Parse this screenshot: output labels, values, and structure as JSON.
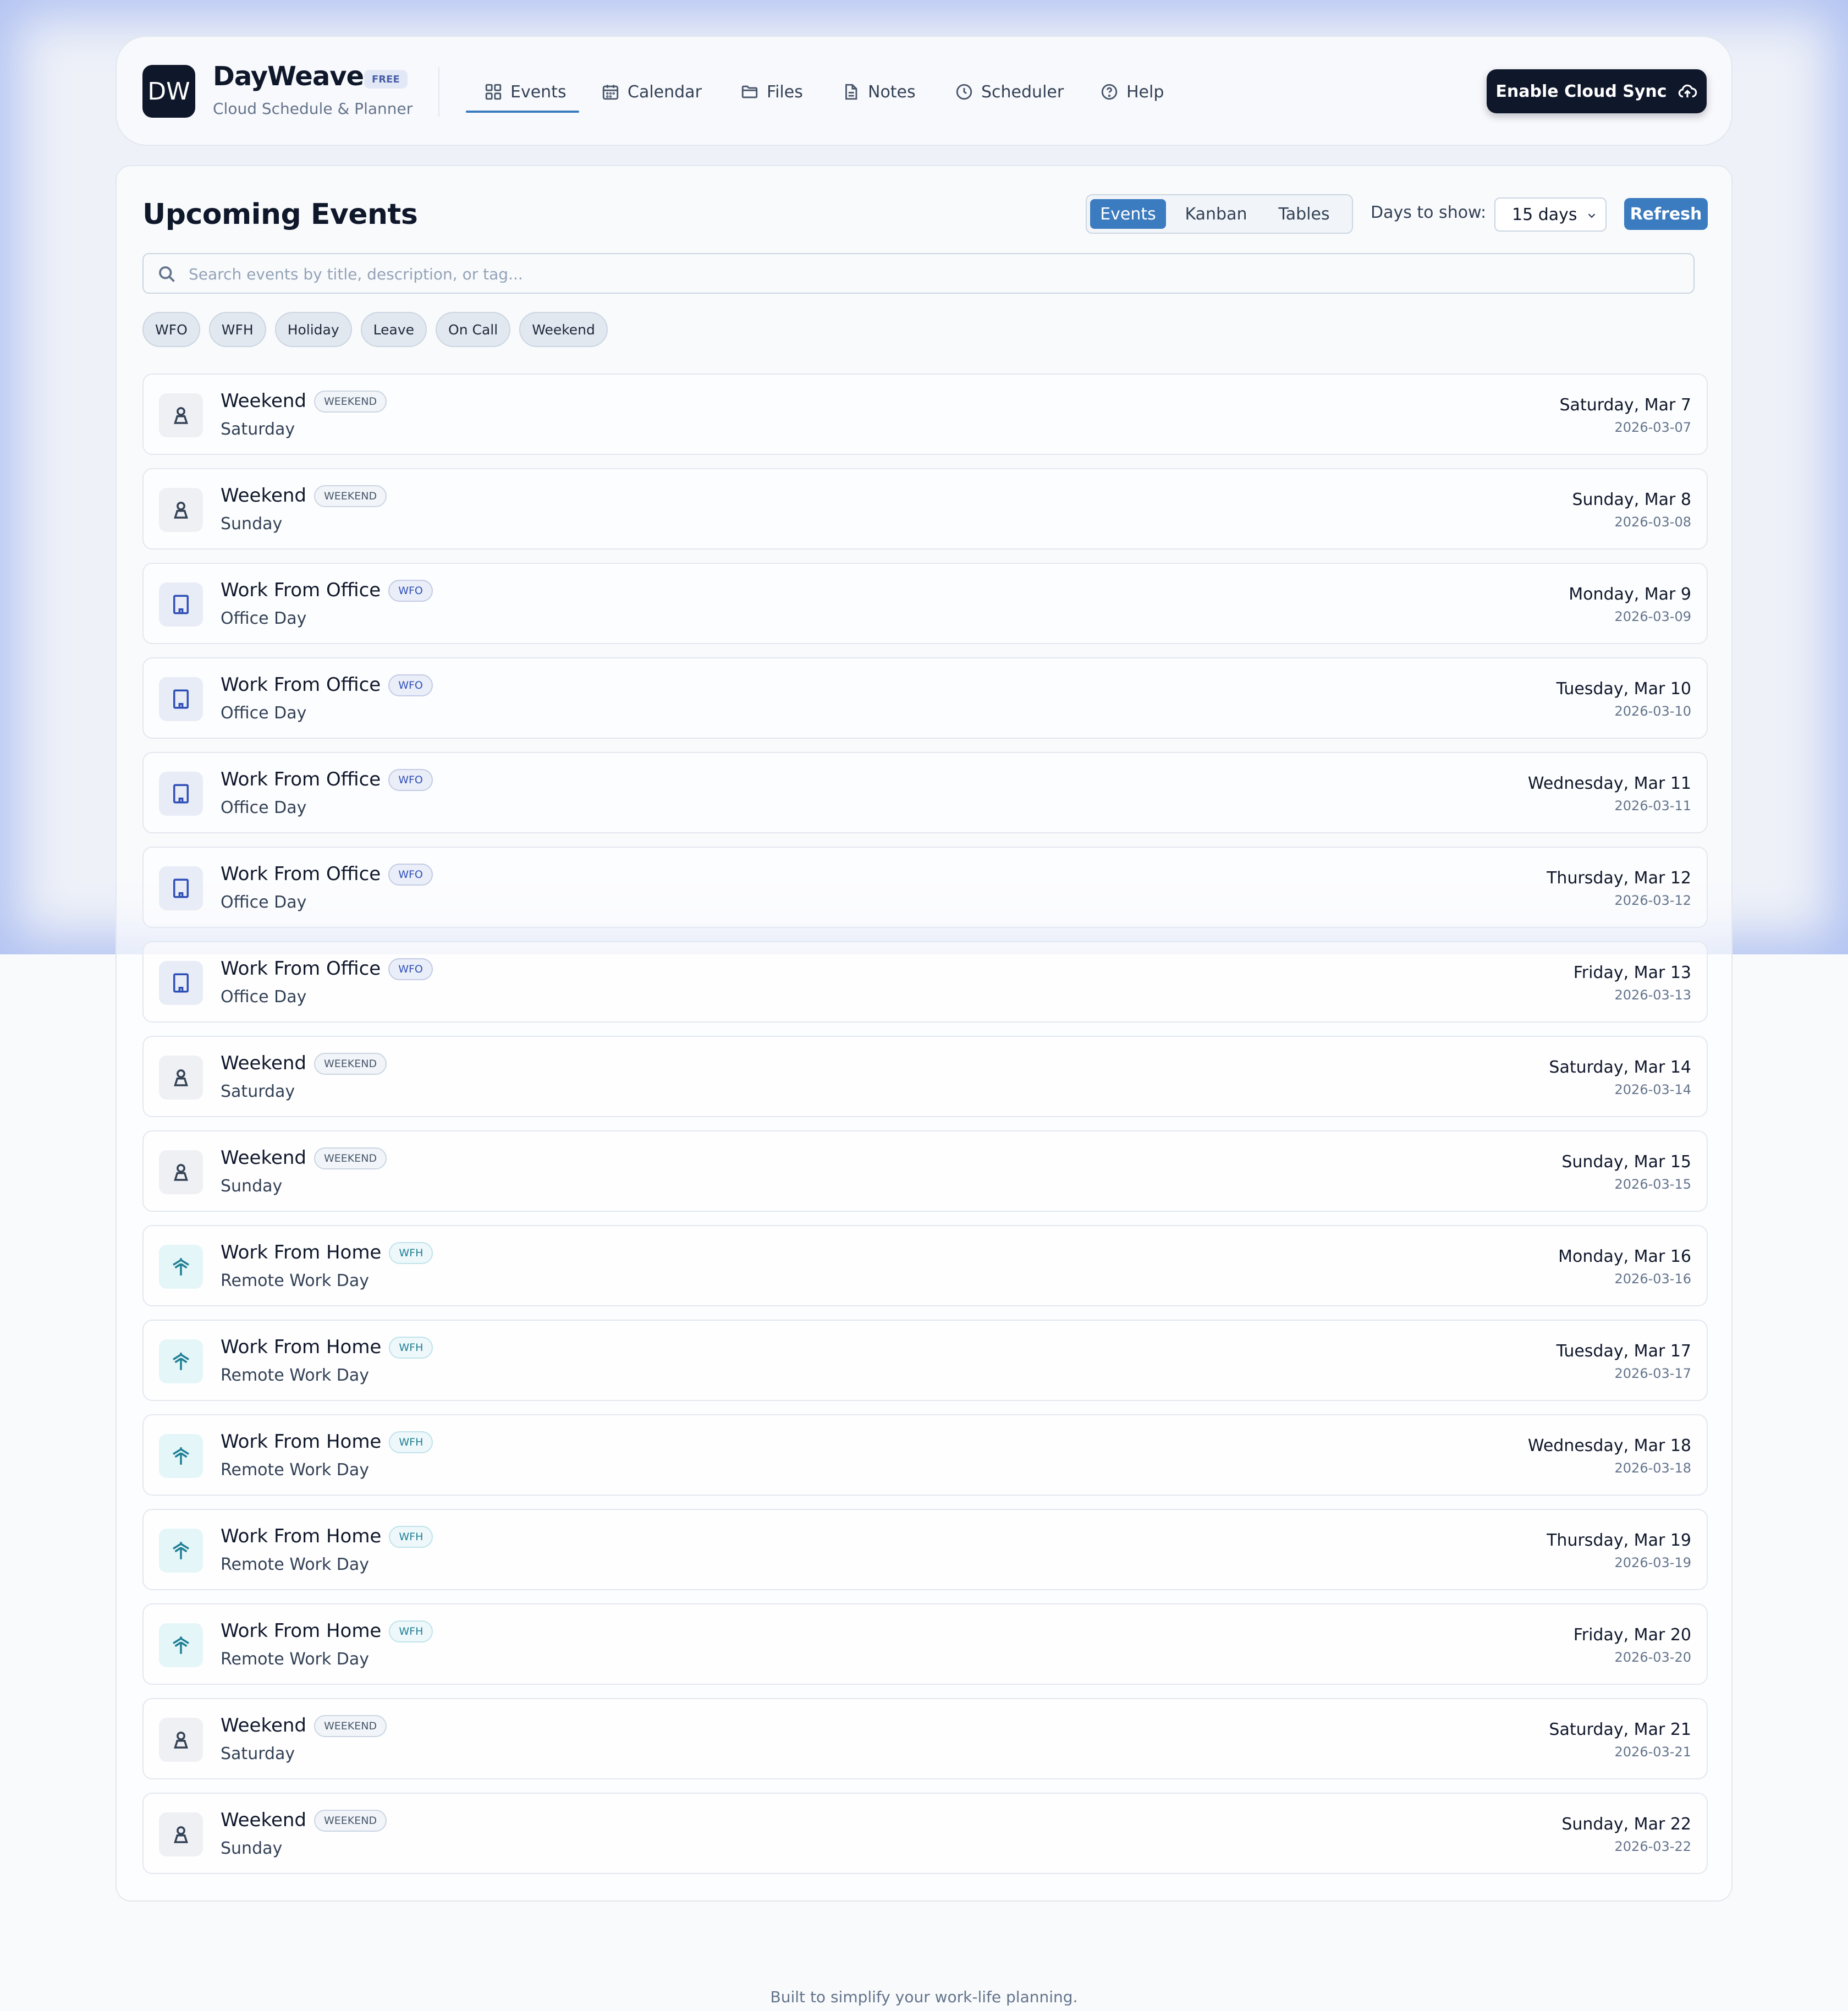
{
  "brand": {
    "logo": "DW",
    "name": "DayWeave",
    "badge": "FREE",
    "subtitle": "Cloud Schedule & Planner"
  },
  "nav": [
    {
      "label": "Events",
      "icon": "grid-icon",
      "active": true
    },
    {
      "label": "Calendar",
      "icon": "calendar-icon"
    },
    {
      "label": "Files",
      "icon": "folder-icon"
    },
    {
      "label": "Notes",
      "icon": "document-icon"
    },
    {
      "label": "Scheduler",
      "icon": "clock-icon"
    },
    {
      "label": "Help",
      "icon": "help-circle-icon"
    }
  ],
  "cloud_button": {
    "label": "Enable Cloud Sync",
    "icon": "cloud-upload-icon"
  },
  "main": {
    "title": "Upcoming Events",
    "views": [
      {
        "label": "Events",
        "active": true
      },
      {
        "label": "Kanban"
      },
      {
        "label": "Tables"
      }
    ],
    "days_label": "Days to show:",
    "days_value": "15 days",
    "refresh_label": "Refresh",
    "search_placeholder": "Search events by title, description, or tag...",
    "search_value": "",
    "tags": [
      "WFO",
      "WFH",
      "Holiday",
      "Leave",
      "On Call",
      "Weekend"
    ]
  },
  "events": [
    {
      "type": "weekend",
      "title": "Weekend",
      "badge": "WEEKEND",
      "subtitle": "Saturday",
      "date": "Saturday, Mar 7",
      "iso": "2026-03-07"
    },
    {
      "type": "weekend",
      "title": "Weekend",
      "badge": "WEEKEND",
      "subtitle": "Sunday",
      "date": "Sunday, Mar 8",
      "iso": "2026-03-08"
    },
    {
      "type": "wfo",
      "title": "Work From Office",
      "badge": "WFO",
      "subtitle": "Office Day",
      "date": "Monday, Mar 9",
      "iso": "2026-03-09"
    },
    {
      "type": "wfo",
      "title": "Work From Office",
      "badge": "WFO",
      "subtitle": "Office Day",
      "date": "Tuesday, Mar 10",
      "iso": "2026-03-10"
    },
    {
      "type": "wfo",
      "title": "Work From Office",
      "badge": "WFO",
      "subtitle": "Office Day",
      "date": "Wednesday, Mar 11",
      "iso": "2026-03-11"
    },
    {
      "type": "wfo",
      "title": "Work From Office",
      "badge": "WFO",
      "subtitle": "Office Day",
      "date": "Thursday, Mar 12",
      "iso": "2026-03-12"
    },
    {
      "type": "wfo",
      "title": "Work From Office",
      "badge": "WFO",
      "subtitle": "Office Day",
      "date": "Friday, Mar 13",
      "iso": "2026-03-13"
    },
    {
      "type": "weekend",
      "title": "Weekend",
      "badge": "WEEKEND",
      "subtitle": "Saturday",
      "date": "Saturday, Mar 14",
      "iso": "2026-03-14"
    },
    {
      "type": "weekend",
      "title": "Weekend",
      "badge": "WEEKEND",
      "subtitle": "Sunday",
      "date": "Sunday, Mar 15",
      "iso": "2026-03-15"
    },
    {
      "type": "wfh",
      "title": "Work From Home",
      "badge": "WFH",
      "subtitle": "Remote Work Day",
      "date": "Monday, Mar 16",
      "iso": "2026-03-16"
    },
    {
      "type": "wfh",
      "title": "Work From Home",
      "badge": "WFH",
      "subtitle": "Remote Work Day",
      "date": "Tuesday, Mar 17",
      "iso": "2026-03-17"
    },
    {
      "type": "wfh",
      "title": "Work From Home",
      "badge": "WFH",
      "subtitle": "Remote Work Day",
      "date": "Wednesday, Mar 18",
      "iso": "2026-03-18"
    },
    {
      "type": "wfh",
      "title": "Work From Home",
      "badge": "WFH",
      "subtitle": "Remote Work Day",
      "date": "Thursday, Mar 19",
      "iso": "2026-03-19"
    },
    {
      "type": "wfh",
      "title": "Work From Home",
      "badge": "WFH",
      "subtitle": "Remote Work Day",
      "date": "Friday, Mar 20",
      "iso": "2026-03-20"
    },
    {
      "type": "weekend",
      "title": "Weekend",
      "badge": "WEEKEND",
      "subtitle": "Saturday",
      "date": "Saturday, Mar 21",
      "iso": "2026-03-21"
    },
    {
      "type": "weekend",
      "title": "Weekend",
      "badge": "WEEKEND",
      "subtitle": "Sunday",
      "date": "Sunday, Mar 22",
      "iso": "2026-03-22"
    }
  ],
  "footer": "Built to simplify your work-life planning.",
  "colors": {
    "accent": "#3b7bbf",
    "dark": "#0f172a",
    "wfo": "#2f4fb8",
    "wfh": "#1f7f94"
  }
}
